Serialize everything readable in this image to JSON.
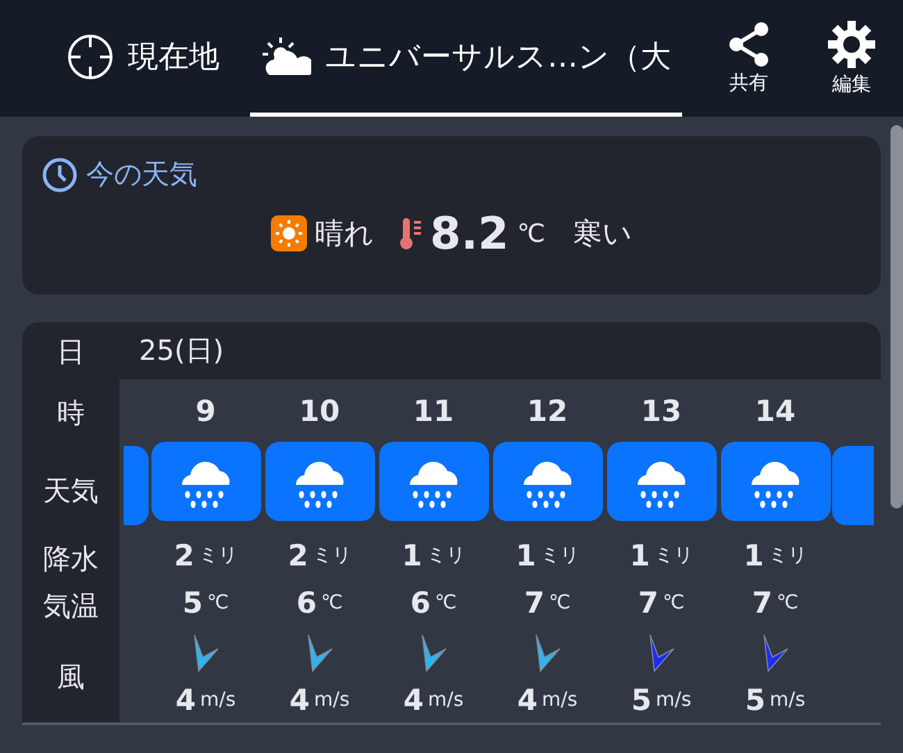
{
  "tabs": [
    {
      "kind": "location",
      "label": "現在地",
      "selected": false
    },
    {
      "kind": "spot",
      "label": "ユニバーサルス…ン（大",
      "selected": true
    }
  ],
  "actions": [
    {
      "kind": "share",
      "label": "共有"
    },
    {
      "kind": "edit",
      "label": "編集"
    }
  ],
  "current": {
    "title": "今の天気",
    "condition": "晴れ",
    "temperature": "8.2",
    "unit": "℃",
    "feel": "寒い"
  },
  "forecast": {
    "labels": {
      "day": "日",
      "hour": "時",
      "weather": "天気",
      "precip": "降水",
      "temp": "気温",
      "wind": "風"
    },
    "day": "25(日)",
    "hours": [
      {
        "hour": "9",
        "precip": "2",
        "precip_unit": "ミリ",
        "temp": "5",
        "temp_unit": "℃",
        "wind": "4",
        "wind_unit": "m/s",
        "color": "#29b6f6"
      },
      {
        "hour": "10",
        "precip": "2",
        "precip_unit": "ミリ",
        "temp": "6",
        "temp_unit": "℃",
        "wind": "4",
        "wind_unit": "m/s",
        "color": "#29b6f6"
      },
      {
        "hour": "11",
        "precip": "1",
        "precip_unit": "ミリ",
        "temp": "6",
        "temp_unit": "℃",
        "wind": "4",
        "wind_unit": "m/s",
        "color": "#29b6f6"
      },
      {
        "hour": "12",
        "precip": "1",
        "precip_unit": "ミリ",
        "temp": "7",
        "temp_unit": "℃",
        "wind": "4",
        "wind_unit": "m/s",
        "color": "#29b6f6"
      },
      {
        "hour": "13",
        "precip": "1",
        "precip_unit": "ミリ",
        "temp": "7",
        "temp_unit": "℃",
        "wind": "5",
        "wind_unit": "m/s",
        "color": "#1a2cff"
      },
      {
        "hour": "14",
        "precip": "1",
        "precip_unit": "ミリ",
        "temp": "7",
        "temp_unit": "℃",
        "wind": "5",
        "wind_unit": "m/s",
        "color": "#1a2cff"
      }
    ]
  }
}
